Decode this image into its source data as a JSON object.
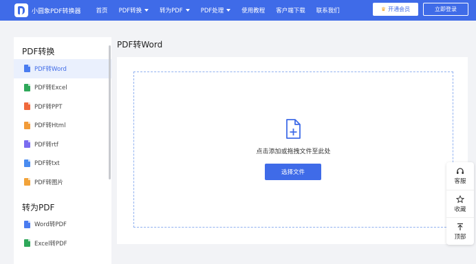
{
  "header": {
    "app_name": "小圆象PDF转换器",
    "nav": [
      {
        "label": "首页",
        "dropdown": false
      },
      {
        "label": "PDF转换",
        "dropdown": true
      },
      {
        "label": "转为PDF",
        "dropdown": true
      },
      {
        "label": "PDF处理",
        "dropdown": true
      },
      {
        "label": "使用教程",
        "dropdown": false
      },
      {
        "label": "客户端下载",
        "dropdown": false
      },
      {
        "label": "联系我们",
        "dropdown": false
      }
    ],
    "vip_button": "开通会员",
    "login_button": "立即登录"
  },
  "sidebar": {
    "groups": [
      {
        "title": "PDF转换",
        "items": [
          {
            "label": "PDF转Word",
            "active": true,
            "icon_color": "#4a7cf0"
          },
          {
            "label": "PDF转Excel",
            "active": false,
            "icon_color": "#2fa85a"
          },
          {
            "label": "PDF转PPT",
            "active": false,
            "icon_color": "#f0693c"
          },
          {
            "label": "PDF转Html",
            "active": false,
            "icon_color": "#f29b38"
          },
          {
            "label": "PDF转rtf",
            "active": false,
            "icon_color": "#7a6cf0"
          },
          {
            "label": "PDF转txt",
            "active": false,
            "icon_color": "#4a8cf0"
          },
          {
            "label": "PDF转图片",
            "active": false,
            "icon_color": "#f2a33a"
          }
        ]
      },
      {
        "title": "转为PDF",
        "items": [
          {
            "label": "Word转PDF",
            "active": false,
            "icon_color": "#4a7cf0"
          },
          {
            "label": "Excel转PDF",
            "active": false,
            "icon_color": "#2fa85a"
          }
        ]
      }
    ]
  },
  "main": {
    "title": "PDF转Word",
    "drop_hint": "点击添加或拖拽文件至此处",
    "choose_button": "选择文件"
  },
  "tools": [
    {
      "label": "客服",
      "icon": "headset-icon"
    },
    {
      "label": "收藏",
      "icon": "star-icon"
    },
    {
      "label": "顶部",
      "icon": "back-to-top-icon"
    }
  ],
  "colors": {
    "brand": "#3f6be8",
    "active_bg": "#eaf0fd",
    "dropzone_border": "#8fb0f0"
  }
}
